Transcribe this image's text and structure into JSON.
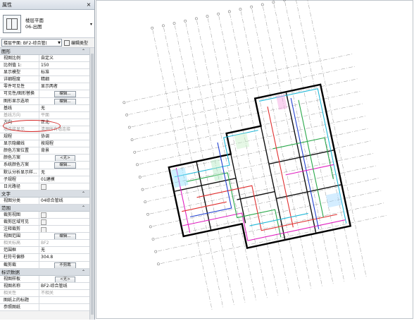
{
  "panel": {
    "title": "属性",
    "close": "×",
    "type_name_line1": "楼层平面",
    "type_name_line2": "06-出图",
    "view_selector": "楼层平面: BF2-综合管(",
    "edit_type": "编辑类型",
    "categories": {
      "graphics": "图形",
      "text": "文字",
      "extents": "范围",
      "identity": "标识数据"
    },
    "collapse_glyph": "⌃",
    "rows_graphics": [
      {
        "label": "视图比例",
        "value": "自定义"
      },
      {
        "label": "比例值 1:",
        "value": "150"
      },
      {
        "label": "显示模型",
        "value": "标准"
      },
      {
        "label": "详细程度",
        "value": "精细"
      },
      {
        "label": "零件可见性",
        "value": "显示两者"
      },
      {
        "label": "可见性/图形替换",
        "value": "编辑...",
        "button": true
      },
      {
        "label": "图形显示选项",
        "value": "编辑...",
        "button": true
      },
      {
        "label": "基线",
        "value": "无"
      },
      {
        "label": "基线方向",
        "value": "平面",
        "disabled": true
      },
      {
        "label": "方向",
        "value": "正北"
      },
      {
        "label": "墙连接显示",
        "value": "清理所有墙连接",
        "disabled": true
      },
      {
        "label": "规程",
        "value": "协调"
      },
      {
        "label": "显示隐藏线",
        "value": "按规程"
      },
      {
        "label": "颜色方案位置",
        "value": "背景"
      },
      {
        "label": "颜色方案",
        "value": "<无>",
        "button": true
      },
      {
        "label": "系统颜色方案",
        "value": "编辑...",
        "button": true
      },
      {
        "label": "默认分析显示样...",
        "value": "无"
      },
      {
        "label": "子规程",
        "value": "01建模"
      },
      {
        "label": "日光路径",
        "value": "",
        "checkbox": true
      }
    ],
    "rows_text": [
      {
        "label": "视图分类",
        "value": "04综合管线"
      }
    ],
    "rows_extents": [
      {
        "label": "裁剪视图",
        "value": "",
        "checkbox": true
      },
      {
        "label": "裁剪区域可见",
        "value": "",
        "checkbox": true
      },
      {
        "label": "注释裁剪",
        "value": "",
        "checkbox": true
      },
      {
        "label": "视图范围",
        "value": "编辑...",
        "button": true
      },
      {
        "label": "相关标高",
        "value": "BF2",
        "disabled": true
      },
      {
        "label": "范围框",
        "value": "无"
      },
      {
        "label": "柱符号偏移",
        "value": "304.8"
      },
      {
        "label": "截剪裁",
        "value": "不剪裁",
        "button": true
      }
    ],
    "rows_identity": [
      {
        "label": "视图样板",
        "value": "<无>",
        "button": true
      },
      {
        "label": "视图名称",
        "value": "BF2-综合管线"
      },
      {
        "label": "相关性",
        "value": "不相关",
        "disabled": true
      },
      {
        "label": "图纸上的标题",
        "value": ""
      },
      {
        "label": "参照图纸",
        "value": ""
      }
    ]
  },
  "colors": {
    "highlight": "#d42a2a",
    "pipe_magenta": "#e020c0",
    "pipe_cyan": "#20b8d8",
    "pipe_green": "#2aa84a",
    "pipe_red": "#e03030",
    "pipe_blue": "#2040d0"
  },
  "icons": [
    "floor-plan-type-icon",
    "edit-type-icon",
    "close-icon",
    "dropdown-arrow-icon"
  ]
}
